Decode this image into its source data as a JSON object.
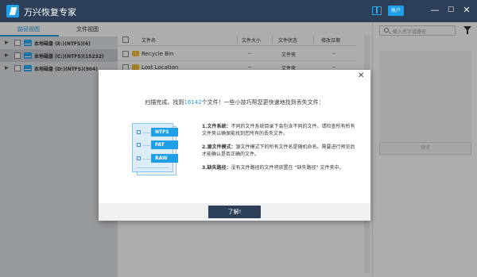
{
  "app": {
    "title": "万兴恢复专家",
    "account_label": "账户",
    "minimize_glyph": "—",
    "maximize_glyph": "☐",
    "close_glyph": "✕"
  },
  "left_panel": {
    "tabs": [
      {
        "label": "路径视图",
        "active": true
      },
      {
        "label": "文件视图",
        "active": false
      }
    ],
    "drives": [
      {
        "label": "本地磁盘 (E:)(NTFS)(6)",
        "selected": false
      },
      {
        "label": "本地磁盘 (C:)(NTFS)(15232)",
        "selected": true
      },
      {
        "label": "本地磁盘 (D:)(NTFS)(904)",
        "selected": false
      }
    ]
  },
  "file_table": {
    "columns": [
      "文件名",
      "文件大小",
      "文件状态",
      "修改日期"
    ],
    "rows": [
      {
        "name": "Recycle Bin",
        "size": "--",
        "status": "文件夹",
        "date": "--"
      },
      {
        "name": "Lost Location",
        "size": "--",
        "status": "文件夹",
        "date": "--"
      }
    ]
  },
  "right_panel": {
    "search_placeholder": "输入名字或路径",
    "preview_label": "预览"
  },
  "dialog": {
    "heading_prefix": "扫描完成。找到",
    "file_count": "16142",
    "heading_suffix": "个文件！一些小技巧帮您更快速地找到丢失文件：",
    "illustration_tags": [
      "NTFS",
      "FAT",
      "RAW"
    ],
    "tips": [
      {
        "title": "1.文件系统：",
        "text": "不同的文件系统目录下会包含不同的文件。请检查所有所有文件夹以确保能找到您所有的丢失文件。"
      },
      {
        "title": "2.源文件模式：",
        "text": "源文件模式下的所有文件名是随机命名。需要进行预览后才能确认是否正确的文件。"
      },
      {
        "title": "3.缺失路径：",
        "text": "没有文件路径的文件将放置在 “缺失路径” 文件夹中。"
      }
    ],
    "ok_label": "了解!",
    "accent_color": "#1e9fe8",
    "button_color": "#2c3e58"
  }
}
